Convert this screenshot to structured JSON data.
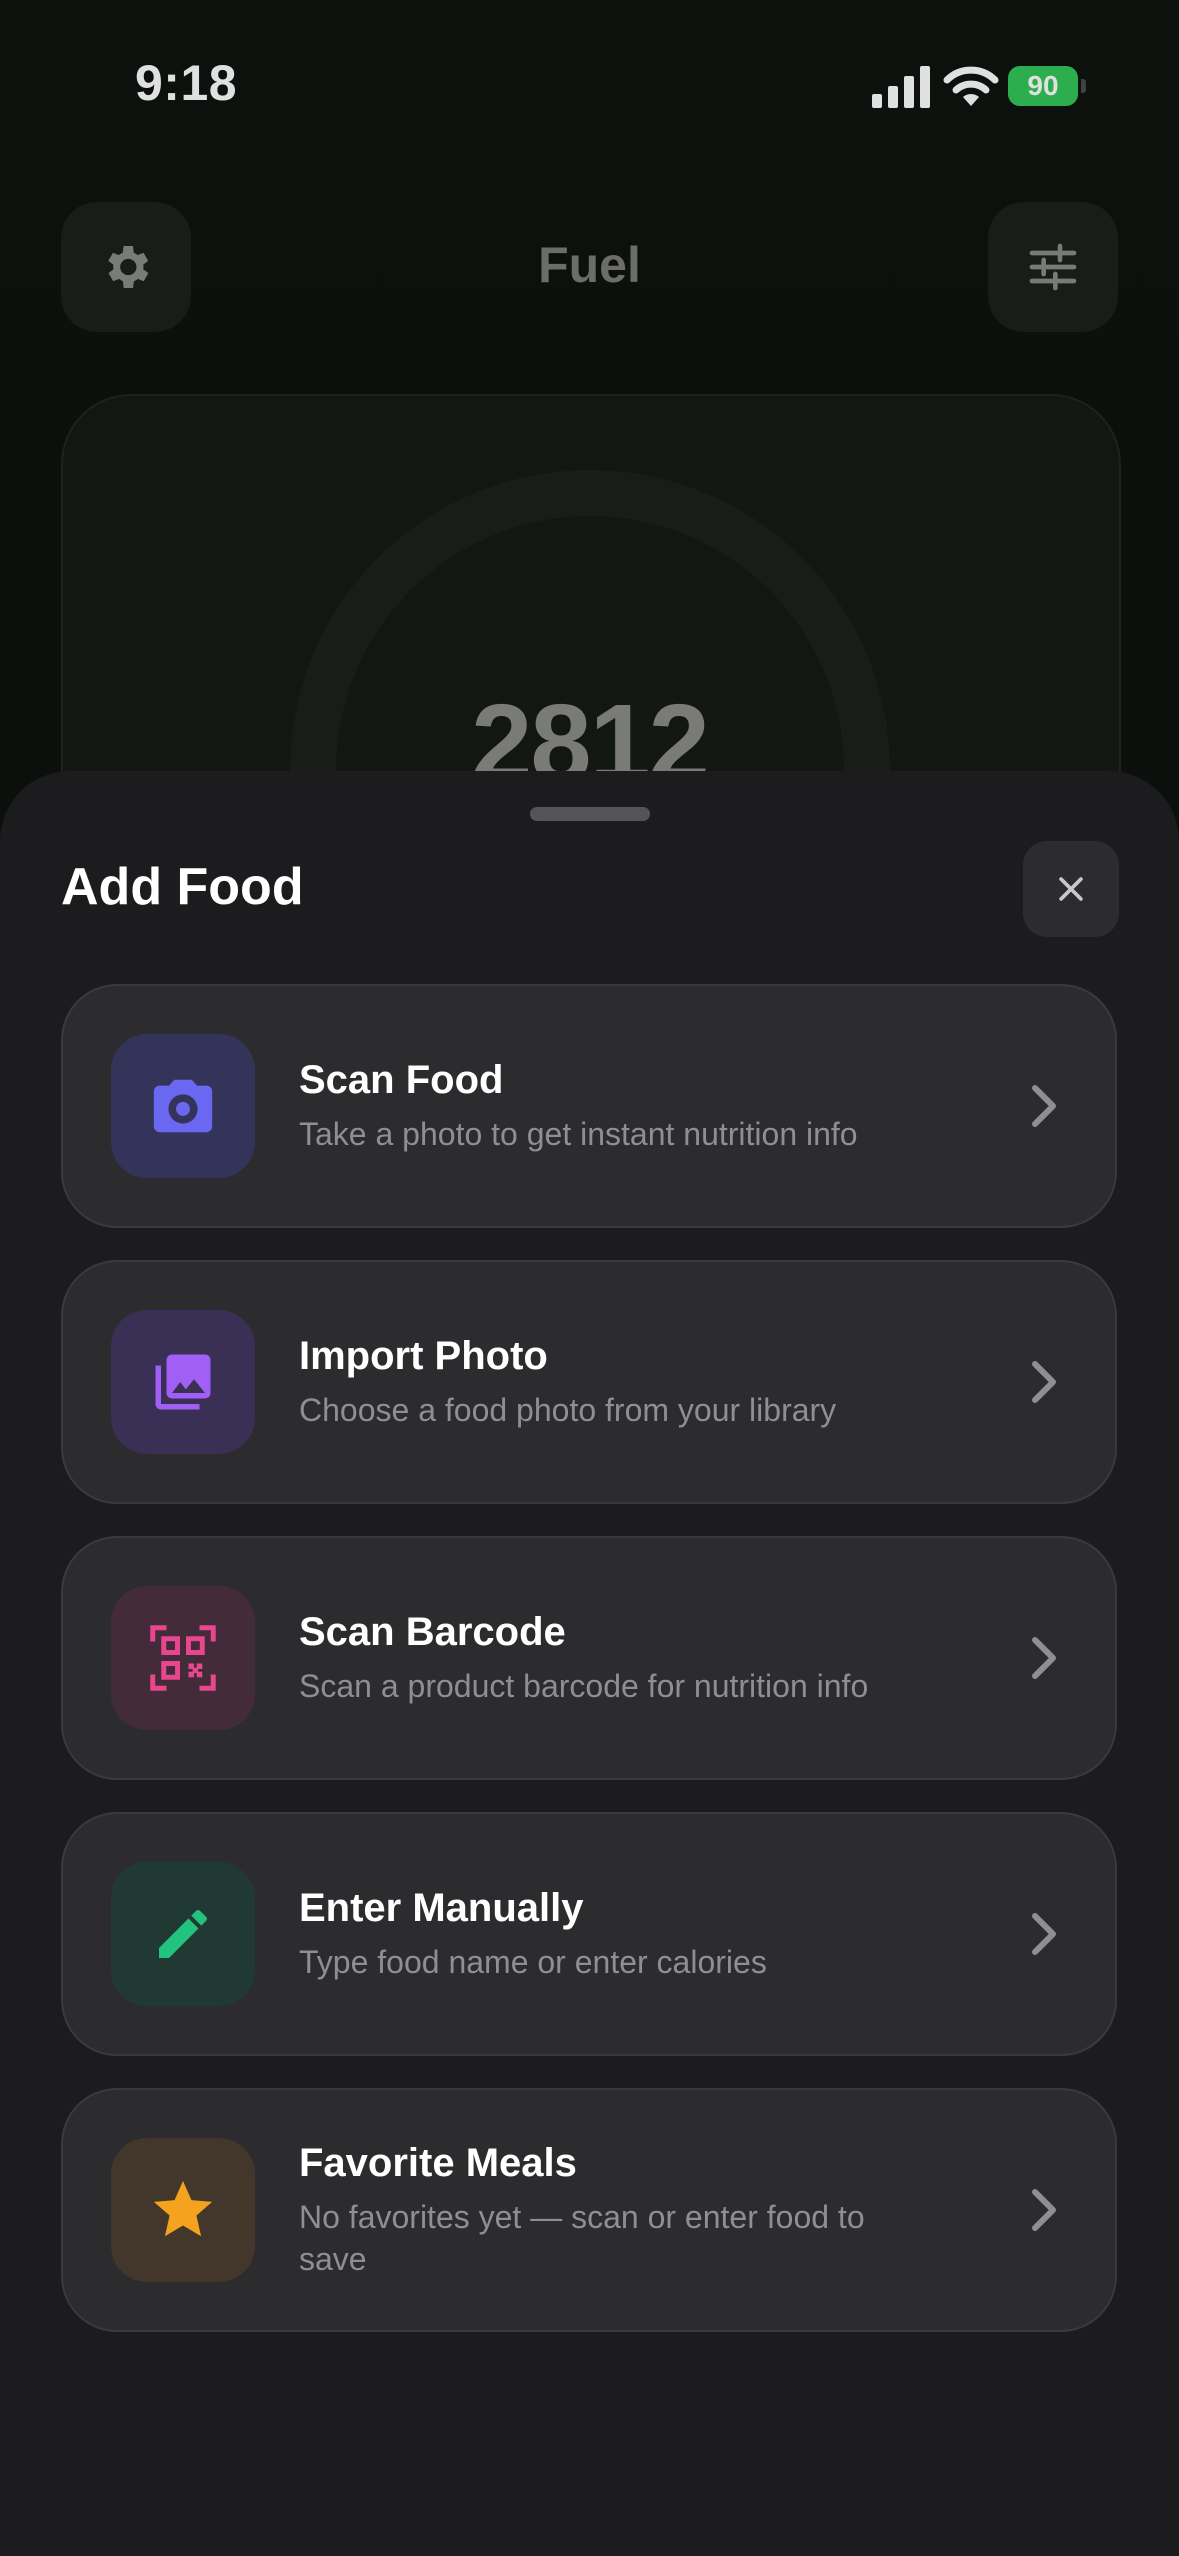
{
  "status_bar": {
    "time": "9:18",
    "battery": "90"
  },
  "app": {
    "title": "Fuel",
    "calories": "2812"
  },
  "sheet": {
    "title": "Add Food",
    "options": [
      {
        "title": "Scan Food",
        "description": "Take a photo to get instant nutrition info",
        "icon": "camera-icon",
        "color": "#5e5ce6"
      },
      {
        "title": "Import Photo",
        "description": "Choose a food photo from your library",
        "icon": "photo-library-icon",
        "color": "#9b59f6"
      },
      {
        "title": "Scan Barcode",
        "description": "Scan a product barcode for nutrition info",
        "icon": "qr-code-icon",
        "color": "#e0468c"
      },
      {
        "title": "Enter Manually",
        "description": "Type food name or enter calories",
        "icon": "pencil-icon",
        "color": "#1fbf7a"
      },
      {
        "title": "Favorite Meals",
        "description": "No favorites yet — scan or enter food to save",
        "icon": "star-icon",
        "color": "#f5a623"
      }
    ]
  }
}
